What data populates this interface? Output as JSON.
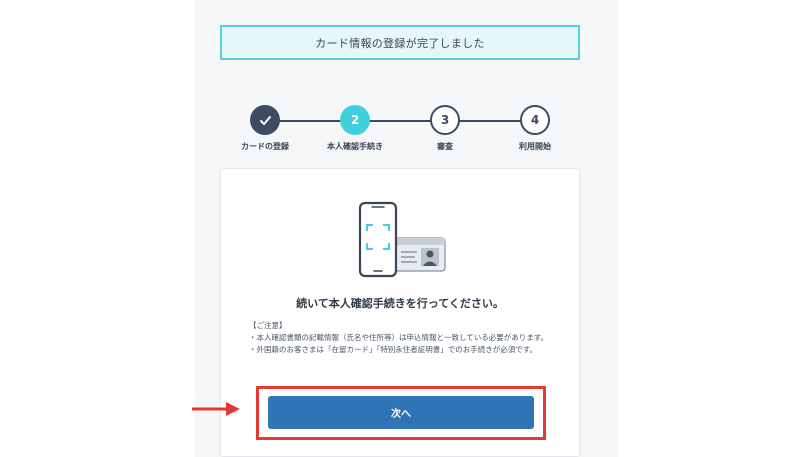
{
  "banner": {
    "text": "カード情報の登録が完了しました"
  },
  "steps": [
    {
      "label": "カードの登録",
      "number": "✓",
      "state": "done"
    },
    {
      "label": "本人確認手続き",
      "number": "2",
      "state": "active"
    },
    {
      "label": "審査",
      "number": "3",
      "state": "todo"
    },
    {
      "label": "利用開始",
      "number": "4",
      "state": "todo"
    }
  ],
  "card": {
    "headline": "続いて本人確認手続きを行ってください。",
    "notice_title": "【ご注意】",
    "notice_items": [
      "・本人確認書類の記載情報（氏名や住所等）は申込情報と一致している必要があります。",
      "・外国籍のお客さまは「在留カード」「特別永住者証明書」でのお手続きが必須です。"
    ],
    "next_label": "次へ"
  },
  "colors": {
    "accent": "#3fd0dc",
    "navy": "#3d4c63",
    "button": "#2f74b5",
    "highlight": "#e53935"
  }
}
